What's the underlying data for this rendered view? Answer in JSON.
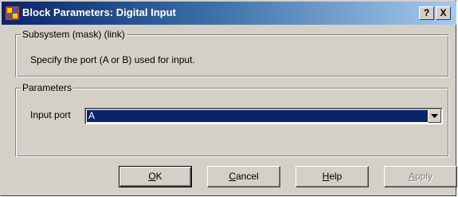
{
  "window": {
    "title": "Block Parameters: Digital Input",
    "help_glyph": "?",
    "close_glyph": "X",
    "icon": "simulink-block-icon"
  },
  "mask_group": {
    "legend": "Subsystem (mask) (link)",
    "description": "Specify the port (A or B) used for input."
  },
  "params_group": {
    "legend": "Parameters",
    "input_port_label": "Input port",
    "input_port_value": "A"
  },
  "buttons": {
    "ok": {
      "mnemonic": "O",
      "rest": "K"
    },
    "cancel": {
      "mnemonic": "C",
      "rest": "ancel"
    },
    "help": {
      "mnemonic": "H",
      "rest": "elp"
    },
    "apply": {
      "mnemonic": "A",
      "rest": "pply",
      "enabled": false
    }
  },
  "colors": {
    "titlebar_start": "#0a246a",
    "titlebar_end": "#a6caf0",
    "dialog_face": "#d4d0c8",
    "selection": "#0a246a"
  }
}
